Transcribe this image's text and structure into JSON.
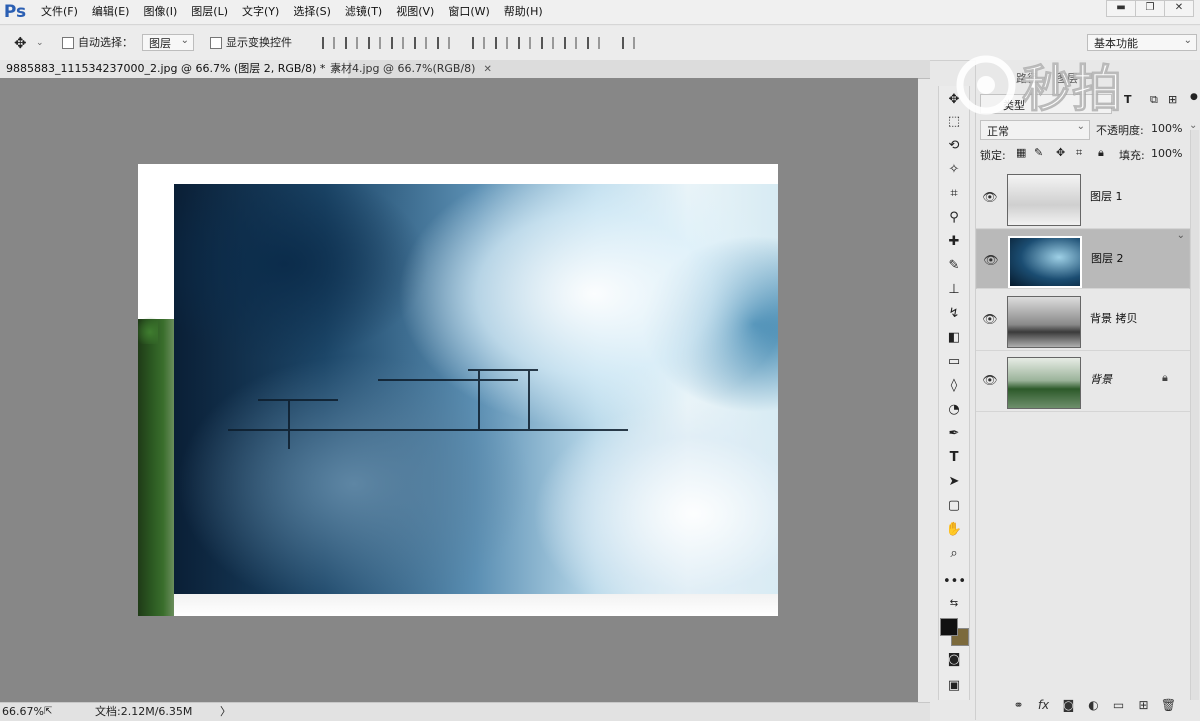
{
  "app": {
    "logo": "Ps",
    "menu": [
      "文件(F)",
      "编辑(E)",
      "图像(I)",
      "图层(L)",
      "文字(Y)",
      "选择(S)",
      "滤镜(T)",
      "视图(V)",
      "窗口(W)",
      "帮助(H)"
    ],
    "window_buttons": [
      "▬",
      "❐",
      "✕"
    ]
  },
  "options": {
    "auto_select_label": "自动选择：",
    "auto_select_value": "图层",
    "show_transform_label": "显示变换控件",
    "workspace": "基本功能"
  },
  "tabs": [
    {
      "label": "9885883_111534237000_2.jpg @ 66.7% (图层 2, RGB/8) *",
      "close": "✕"
    },
    {
      "label": "素材4.jpg @ 66.7%(RGB/8)",
      "close": "✕"
    }
  ],
  "status": {
    "zoom": "66.67%",
    "doc_label": "文档:2.12M/6.35M",
    "arrow": "〉"
  },
  "panel": {
    "tab_labels": [
      "路径",
      "图层"
    ],
    "kind_label": "类型",
    "blend_mode": "正常",
    "opacity_label": "不透明度:",
    "opacity_value": "100%",
    "lock_label": "锁定:",
    "fill_label": "填充:",
    "fill_value": "100%",
    "layers": [
      {
        "name": "图层 1",
        "selected": false
      },
      {
        "name": "图层 2",
        "selected": true
      },
      {
        "name": "背景 拷贝",
        "selected": false
      },
      {
        "name": "背景",
        "selected": false,
        "locked": true
      }
    ],
    "bottom_icons": [
      "link-icon",
      "fx-icon",
      "mask-icon",
      "adjustment-icon",
      "group-folder-icon",
      "new-layer-icon",
      "trash-icon"
    ]
  },
  "watermark": "秒拍",
  "colors": {
    "foreground": "#111111",
    "background": "#7c6a3c"
  }
}
